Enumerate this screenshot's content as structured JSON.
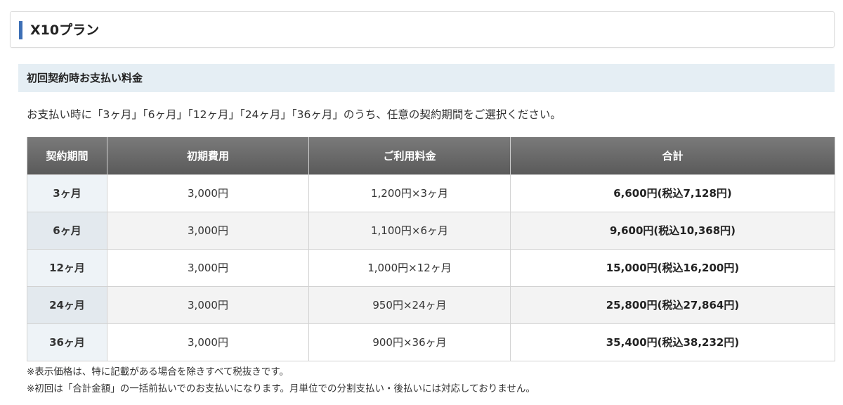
{
  "plan": {
    "title": "X10プラン"
  },
  "section": {
    "title": "初回契約時お支払い料金"
  },
  "intro": "お支払い時に「3ヶ月」「6ヶ月」「12ヶ月」「24ヶ月」「36ヶ月」のうち、任意の契約期間をご選択ください。",
  "table": {
    "headers": [
      "契約期間",
      "初期費用",
      "ご利用料金",
      "合計"
    ],
    "rows": [
      {
        "period": "3ヶ月",
        "initial": "3,000円",
        "usage": "1,200円×3ヶ月",
        "total": "6,600円(税込7,128円)"
      },
      {
        "period": "6ヶ月",
        "initial": "3,000円",
        "usage": "1,100円×6ヶ月",
        "total": "9,600円(税込10,368円)"
      },
      {
        "period": "12ヶ月",
        "initial": "3,000円",
        "usage": "1,000円×12ヶ月",
        "total": "15,000円(税込16,200円)"
      },
      {
        "period": "24ヶ月",
        "initial": "3,000円",
        "usage": "950円×24ヶ月",
        "total": "25,800円(税込27,864円)"
      },
      {
        "period": "36ヶ月",
        "initial": "3,000円",
        "usage": "900円×36ヶ月",
        "total": "35,400円(税込38,232円)"
      }
    ]
  },
  "notes": [
    "※表示価格は、特に記載がある場合を除きすべて税抜きです。",
    "※初回は「合計金額」の一括前払いでのお支払いになります。月単位での分割支払い・後払いには対応しておりません。"
  ]
}
